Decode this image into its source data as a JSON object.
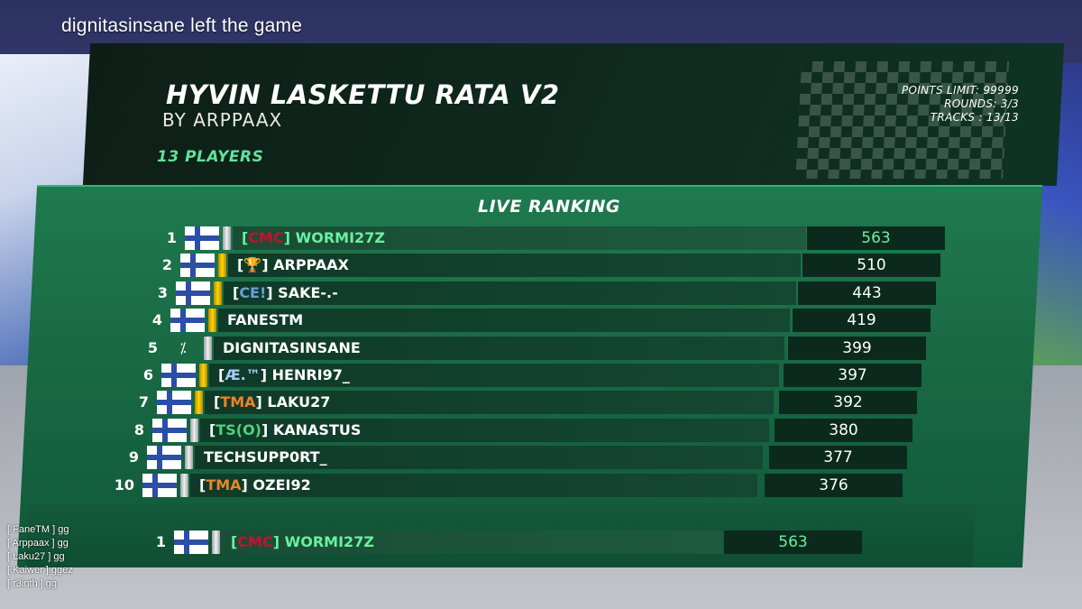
{
  "notice": "dignitasinsane left the game",
  "chat": [
    "[ FaneTM ] gg",
    "[ Arppaax ] gg",
    "[ Laku27 ] gg",
    "[ Kaiwer ] ggez",
    "[ r3inth ] gg"
  ],
  "header": {
    "title": "HYVIN LASKETTU RATA V2",
    "author": "BY ARPPAAX",
    "players": "13 PLAYERS",
    "points_limit": "POINTS LIMIT: 99999",
    "rounds": "ROUNDS: 3/3",
    "tracks": "TRACKS : 13/13"
  },
  "ranking": {
    "title": "LIVE RANKING",
    "rows": [
      {
        "rank": "1",
        "tag": "CMC",
        "tag_color": "#c8102e",
        "name": "WORMI27Z",
        "score": "563",
        "flag": "finland",
        "medal": "silver",
        "selected": true
      },
      {
        "rank": "2",
        "tag": "🏆",
        "tag_color": "#ffffff",
        "name": "ARPPAAX",
        "score": "510",
        "flag": "finland",
        "medal": "gold",
        "selected": false
      },
      {
        "rank": "3",
        "tag": "CE!",
        "tag_color": "#6a9fd4",
        "name": "SAKE-.-",
        "score": "443",
        "flag": "finland",
        "medal": "gold",
        "selected": false
      },
      {
        "rank": "4",
        "tag": "",
        "tag_color": "",
        "name": "FANESTM",
        "score": "419",
        "flag": "finland",
        "medal": "gold",
        "selected": false
      },
      {
        "rank": "5",
        "tag": "",
        "tag_color": "",
        "name": "DIGNITASINSANE",
        "score": "399",
        "flag": "none",
        "medal": "silver",
        "selected": false
      },
      {
        "rank": "6",
        "tag": "Æ.™",
        "tag_color": "#a9c8ff",
        "name": "HENRI97_",
        "score": "397",
        "flag": "finland",
        "medal": "gold",
        "selected": false
      },
      {
        "rank": "7",
        "tag": "TMA",
        "tag_color": "#e9852a",
        "name": "LAKU27",
        "score": "392",
        "flag": "finland",
        "medal": "gold",
        "selected": false
      },
      {
        "rank": "8",
        "tag": "TS(O)",
        "tag_color": "#52d07a",
        "name": "KANASTUS",
        "score": "380",
        "flag": "finland",
        "medal": "silver",
        "selected": false
      },
      {
        "rank": "9",
        "tag": "",
        "tag_color": "",
        "name": "TECHSUPP0RT_",
        "score": "377",
        "flag": "finland",
        "medal": "silver",
        "selected": false
      },
      {
        "rank": "10",
        "tag": "TMA",
        "tag_color": "#e9852a",
        "name": "OZEI92",
        "score": "376",
        "flag": "finland",
        "medal": "silver",
        "selected": false
      }
    ],
    "self": {
      "rank": "1",
      "tag": "CMC",
      "tag_color": "#c8102e",
      "name": "WORMI27Z",
      "score": "563",
      "flag": "finland",
      "medal": "silver"
    }
  }
}
